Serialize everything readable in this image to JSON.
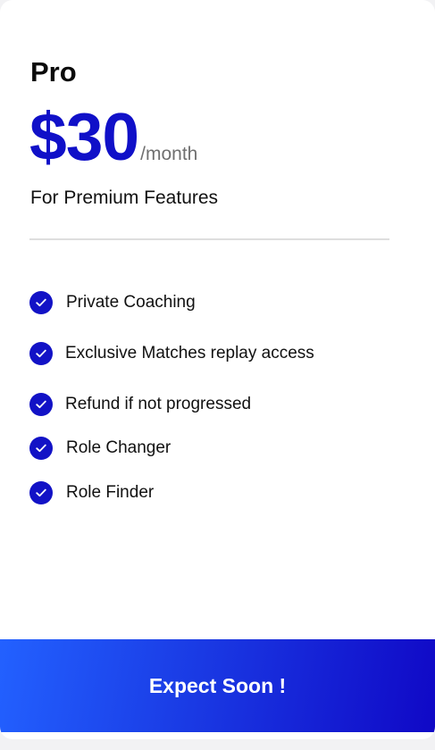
{
  "plan": {
    "name": "Pro",
    "price": "$30",
    "period": "/month",
    "tagline": "For Premium Features"
  },
  "features": [
    "Private Coaching",
    "Exclusive Matches replay access",
    "Refund if not progressed",
    "Role Changer",
    "Role Finder"
  ],
  "cta": {
    "label": "Expect Soon !"
  },
  "colors": {
    "accent": "#1212c6",
    "cta_gradient_start": "#2361ff",
    "cta_gradient_end": "#1008c6"
  },
  "icons": {
    "feature_check": "check-circle-icon"
  }
}
